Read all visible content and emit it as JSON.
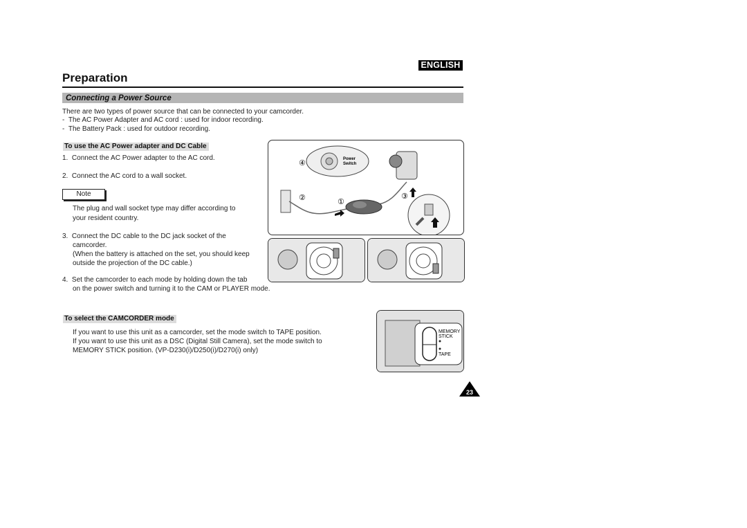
{
  "header": {
    "language_badge": "ENGLISH",
    "page_title": "Preparation"
  },
  "section": {
    "title": "Connecting a Power Source",
    "intro": "There are two types of power source that can be connected to your camcorder.",
    "bullets": [
      "The AC Power Adapter and AC cord : used for indoor recording.",
      "The Battery Pack : used for outdoor recording."
    ]
  },
  "ac_adapter": {
    "heading": "To use the AC Power adapter and DC Cable",
    "steps": [
      {
        "num": "1.",
        "text": "Connect the AC Power adapter to the AC cord."
      },
      {
        "num": "2.",
        "text": "Connect the AC cord to a wall socket."
      },
      {
        "num": "3.",
        "text": "Connect the DC cable to the DC jack socket of the",
        "cont": [
          "camcorder.",
          "(When the battery is attached on the set, you should keep",
          "outside the projection of the DC cable.)"
        ]
      },
      {
        "num": "4.",
        "text": "Set the camcorder to each mode by holding down the tab",
        "cont": [
          "on the power switch and turning it to the CAM or PLAYER mode."
        ]
      }
    ],
    "note_label": "Note",
    "note_lines": [
      "The plug and wall socket type may differ according to",
      "your resident country."
    ]
  },
  "camcorder_mode": {
    "heading": "To select the CAMCORDER mode",
    "lines": [
      "If you want to use this unit as a camcorder, set the mode switch to TAPE position.",
      "If you want to use this unit as a DSC (Digital Still Camera), set the mode switch to",
      "MEMORY STICK position. (VP-D230(i)/D250(i)/D270(i) only)"
    ]
  },
  "illustrations": {
    "connection": {
      "callouts": [
        "④",
        "②",
        "①",
        "③"
      ],
      "power_switch_label": [
        "Power",
        "Switch"
      ]
    },
    "mode_switch": {
      "labels": [
        "MEMORY",
        "STICK",
        "TAPE"
      ]
    }
  },
  "footer": {
    "page_number": "23"
  }
}
